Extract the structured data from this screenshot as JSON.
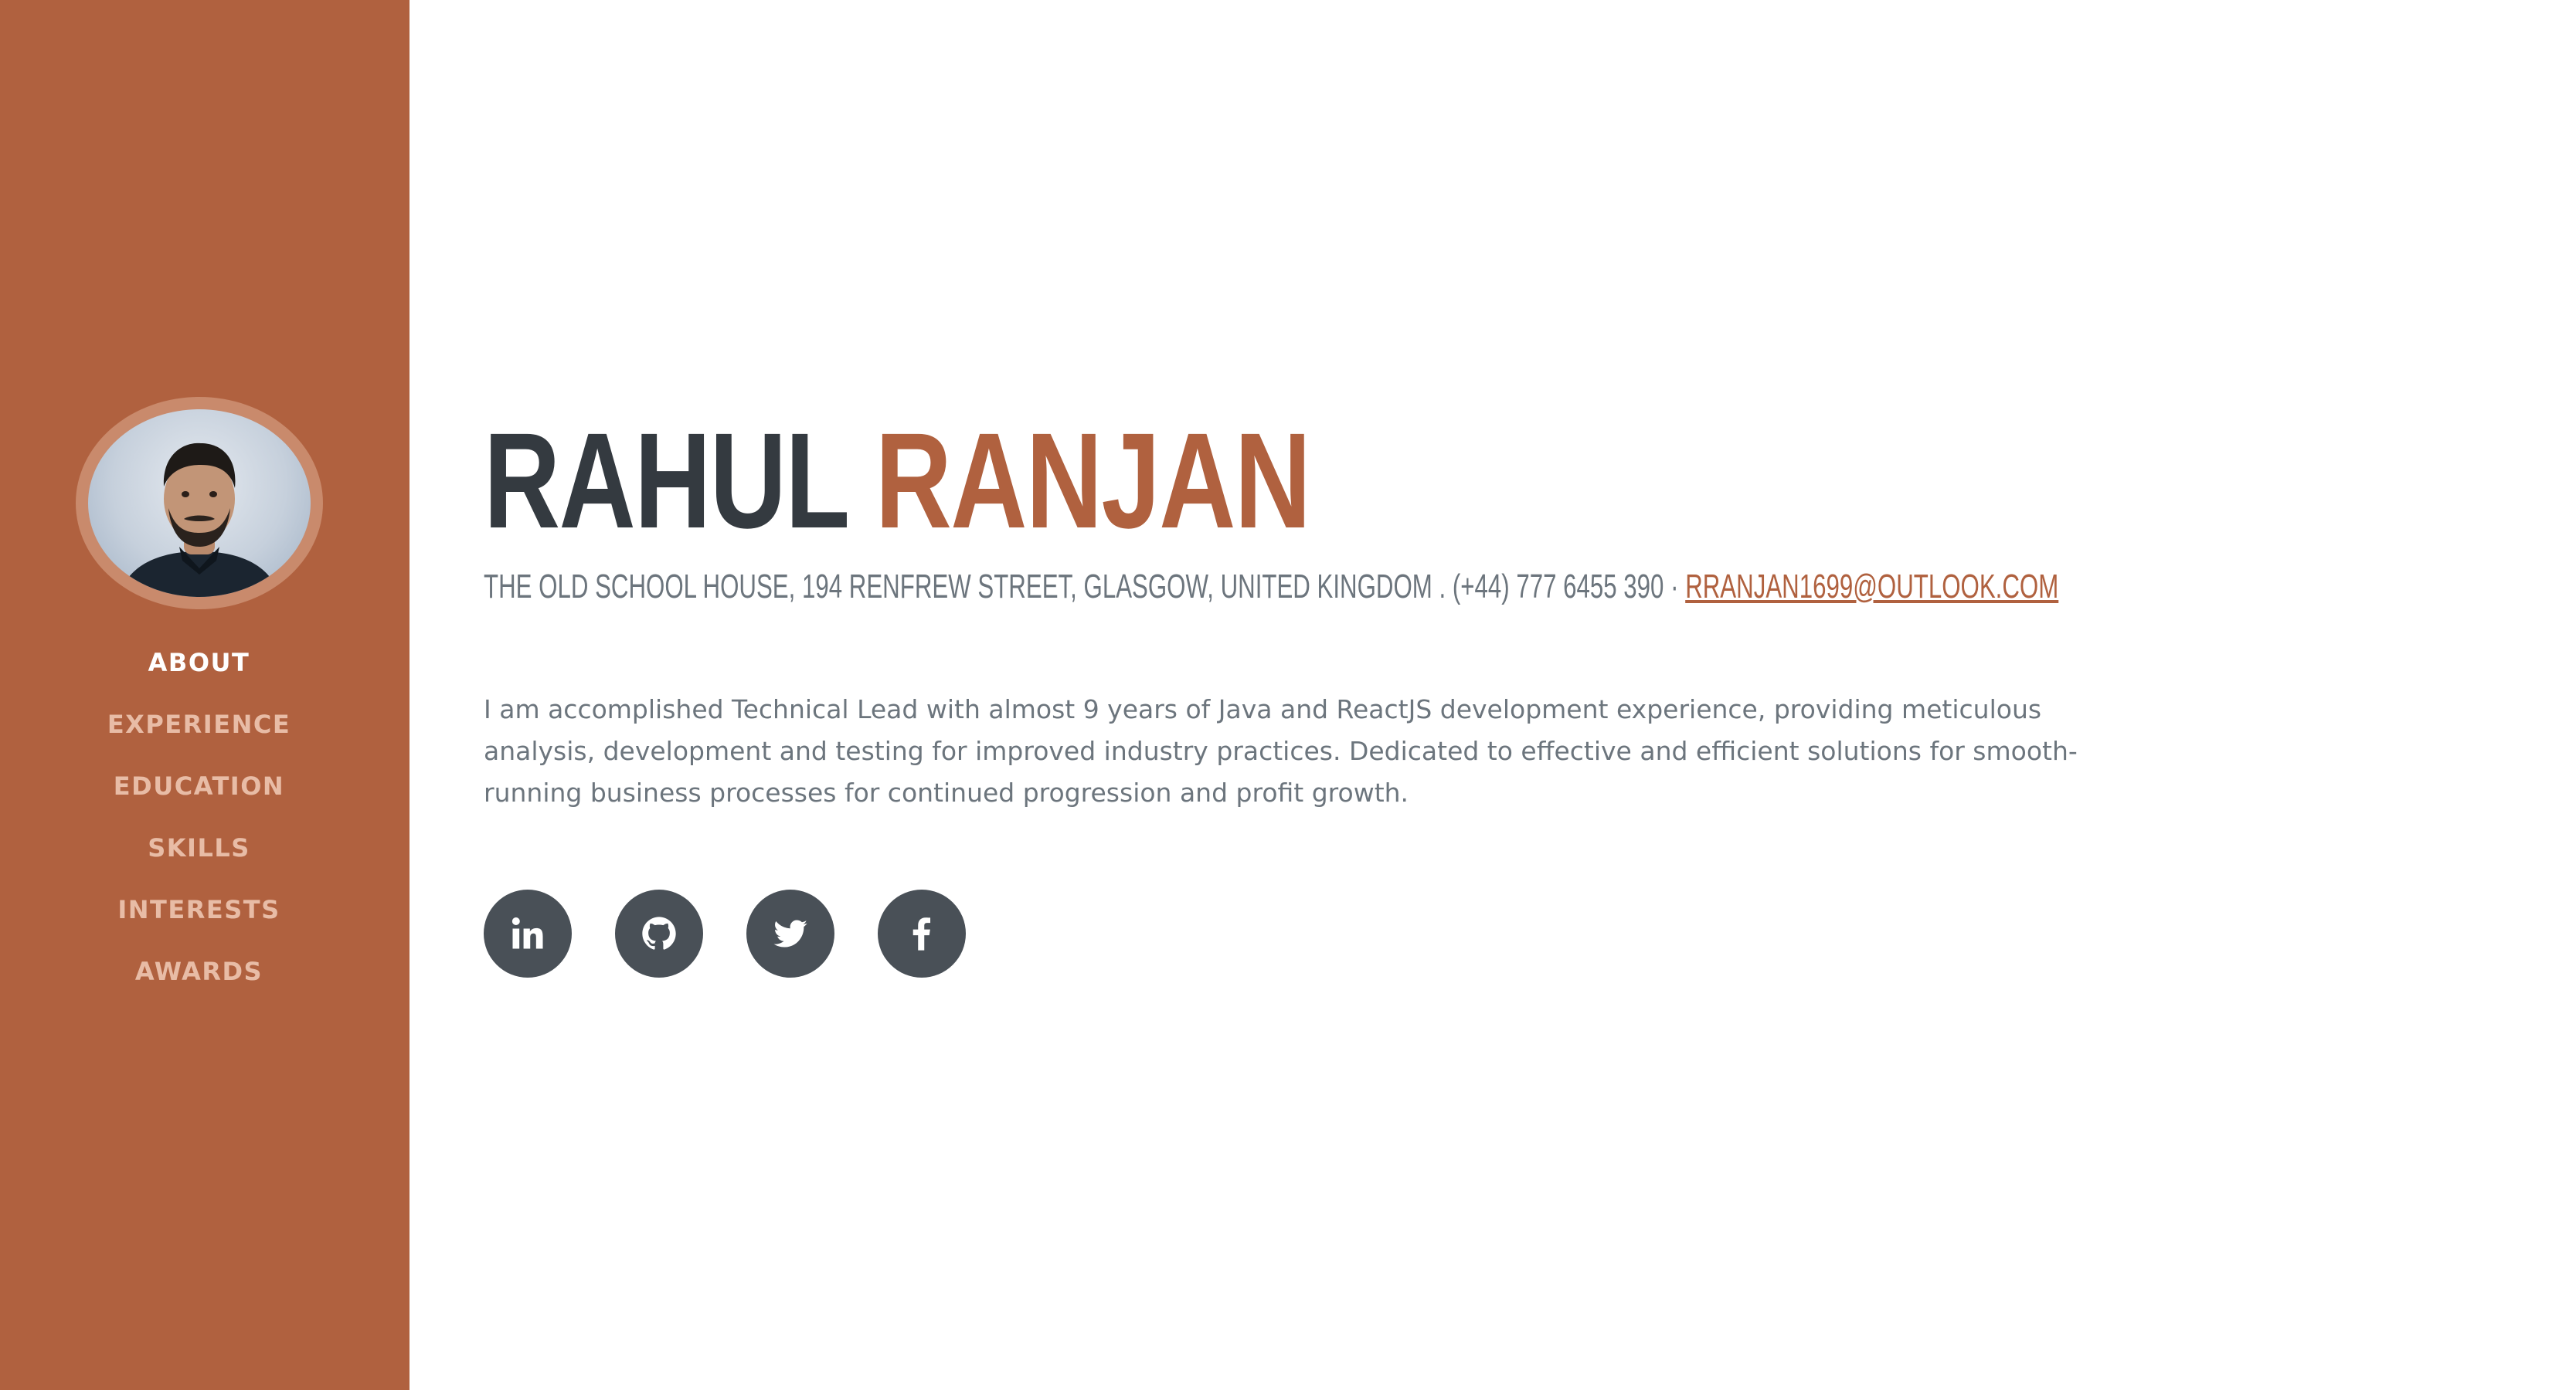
{
  "colors": {
    "primary": "#b0613f",
    "dark": "#343a40",
    "muted": "#6c757d",
    "social_bg": "#495057"
  },
  "sidebar": {
    "nav": [
      {
        "label": "ABOUT",
        "active": true
      },
      {
        "label": "EXPERIENCE",
        "active": false
      },
      {
        "label": "EDUCATION",
        "active": false
      },
      {
        "label": "SKILLS",
        "active": false
      },
      {
        "label": "INTERESTS",
        "active": false
      },
      {
        "label": "AWARDS",
        "active": false
      }
    ]
  },
  "about": {
    "first_name": "RAHUL",
    "last_name": "RANJAN",
    "address": "THE OLD SCHOOL HOUSE, 194 RENFREW STREET, GLASGOW, UNITED KINGDOM . (+44) 777 6455 390 · ",
    "email": "RRANJAN1699@OUTLOOK.COM",
    "summary": "I am accomplished Technical Lead with almost 9 years of Java and ReactJS development experience, providing meticulous analysis, development and testing for improved industry practices. Dedicated to effective and efficient solutions for smooth-running business processes for continued progression and profit growth."
  },
  "social": [
    {
      "icon": "linkedin-icon"
    },
    {
      "icon": "github-icon"
    },
    {
      "icon": "twitter-icon"
    },
    {
      "icon": "facebook-icon"
    }
  ]
}
